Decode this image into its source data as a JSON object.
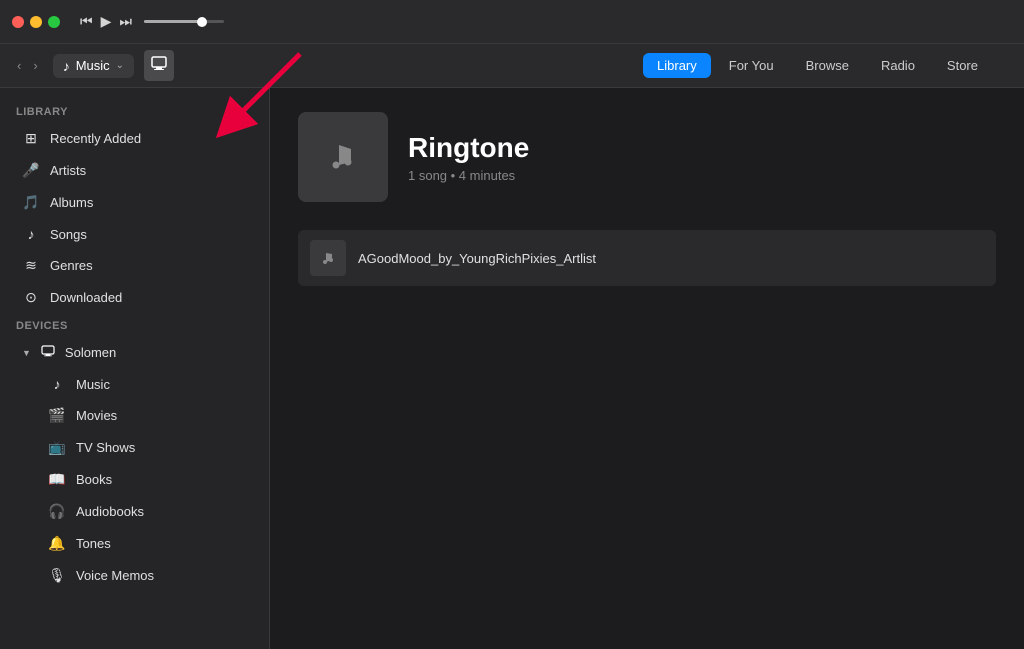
{
  "window": {
    "traffic_lights": [
      "red",
      "yellow",
      "green"
    ],
    "transport": {
      "rewind": "⏮",
      "play": "▶",
      "fast_forward": "⏭"
    },
    "apple_logo": ""
  },
  "toolbar": {
    "nav_back": "‹",
    "nav_forward": "›",
    "source_icon": "♪",
    "source_label": "Music",
    "device_icon": "▭"
  },
  "nav_tabs": [
    {
      "label": "Library",
      "active": true
    },
    {
      "label": "For You",
      "active": false
    },
    {
      "label": "Browse",
      "active": false
    },
    {
      "label": "Radio",
      "active": false
    },
    {
      "label": "Store",
      "active": false
    }
  ],
  "sidebar": {
    "library_section_label": "Library",
    "library_items": [
      {
        "icon": "⊞",
        "label": "Recently Added"
      },
      {
        "icon": "🎤",
        "label": "Artists"
      },
      {
        "icon": "🎵",
        "label": "Albums"
      },
      {
        "icon": "♪",
        "label": "Songs"
      },
      {
        "icon": "≋",
        "label": "Genres"
      },
      {
        "icon": "⊙",
        "label": "Downloaded"
      }
    ],
    "devices_section_label": "Devices",
    "device": {
      "name": "Solomen",
      "chevron": "▼",
      "sub_items": [
        {
          "icon": "♪",
          "label": "Music"
        },
        {
          "icon": "🎬",
          "label": "Movies"
        },
        {
          "icon": "📺",
          "label": "TV Shows"
        },
        {
          "icon": "📖",
          "label": "Books"
        },
        {
          "icon": "🎧",
          "label": "Audiobooks"
        },
        {
          "icon": "🔔",
          "label": "Tones"
        },
        {
          "icon": "🎙",
          "label": "Voice Memos"
        }
      ]
    }
  },
  "content": {
    "album_art_icon": "♪",
    "title": "Ringtone",
    "subtitle": "1 song • 4 minutes",
    "tracks": [
      {
        "icon": "♪",
        "name": "AGoodMood_by_YoungRichPixies_Artlist"
      }
    ]
  }
}
